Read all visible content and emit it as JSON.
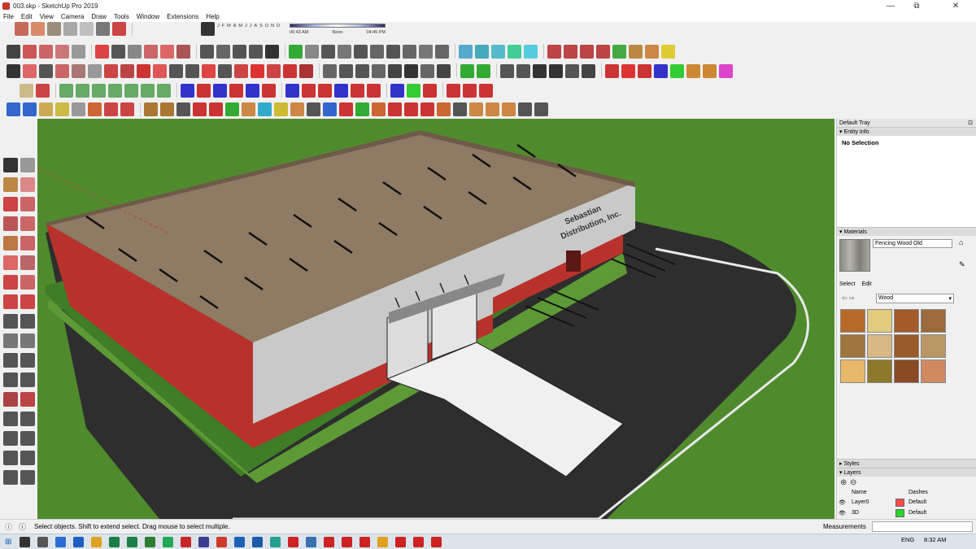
{
  "window": {
    "title": "003.skp - SketchUp Pro 2019",
    "min_glyph": "—",
    "max_glyph": "⧉",
    "close_glyph": "✕"
  },
  "menu": {
    "items": [
      "File",
      "Edit",
      "View",
      "Camera",
      "Draw",
      "Tools",
      "Window",
      "Extensions",
      "Help"
    ]
  },
  "shadow": {
    "months": [
      "J",
      "F",
      "M",
      "A",
      "M",
      "J",
      "J",
      "A",
      "S",
      "O",
      "N",
      "D"
    ],
    "time_start": "06:43 AM",
    "time_mid": "Noon",
    "time_end": "04:45 PM"
  },
  "viewport": {
    "sign_text_line1": "Sebastian",
    "sign_text_line2": "Distribution, Inc."
  },
  "tray": {
    "title": "Default Tray",
    "entity_info": {
      "header": "Entity Info",
      "selection": "No Selection"
    },
    "materials": {
      "header": "Materials",
      "material_name": "Fencing Wood Old",
      "tab_select": "Select",
      "tab_edit": "Edit",
      "collection": "Wood",
      "swatch_colors": [
        "#b56a2a",
        "#e3cb7e",
        "#a55a2c",
        "#9c6a3c",
        "#a0743d",
        "#d8b986",
        "#9a5b2a",
        "#b89765",
        "#e8b86a",
        "#8c7a2a",
        "#8a4a24",
        "#d08a60"
      ]
    },
    "styles": {
      "header": "Styles"
    },
    "layers": {
      "header": "Layers",
      "col_name": "Name",
      "col_dashes": "Dashes",
      "rows": [
        {
          "name": "Layer0",
          "color": "#ff4a4a",
          "dashes": "Default"
        },
        {
          "name": "3D",
          "color": "#2bd62b",
          "dashes": "Default"
        }
      ]
    }
  },
  "status": {
    "message": "Select objects. Shift to extend select. Drag mouse to select multiple.",
    "measurements_label": "Measurements"
  },
  "taskbar": {
    "language": "ENG",
    "time": "8:32 AM"
  },
  "colors": {
    "grass": "#4e8a2e",
    "roof": "#8f7a63",
    "brick": "#b9312a",
    "asphalt": "#2f2f2f",
    "wall": "#c7c7c7"
  }
}
